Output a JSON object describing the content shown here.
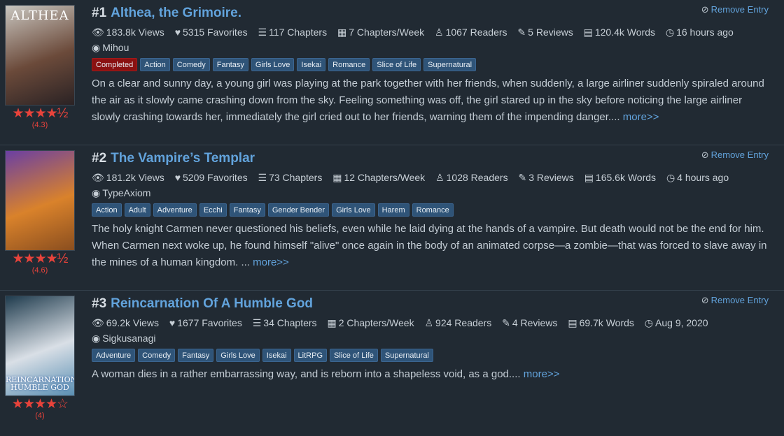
{
  "entries": [
    {
      "rank": "#1",
      "title": "Althea, the Grimoire.",
      "remove_label": "Remove Entry",
      "cover_title": "ALTHEA",
      "cover_bottom": "",
      "cover_colors": [
        "#c9c6c0",
        "#6b4a3a",
        "#2a2224"
      ],
      "stars": "★★★★½",
      "rating": "(4.3)",
      "stats": {
        "views": "183.8k Views",
        "favorites": "5315 Favorites",
        "chapters": "117 Chapters",
        "frequency": "7 Chapters/Week",
        "readers": "1067 Readers",
        "reviews": "5 Reviews",
        "words": "120.4k Words",
        "updated": "16 hours ago"
      },
      "author": "Mihou",
      "status_tag": "Completed",
      "tags": [
        "Action",
        "Comedy",
        "Fantasy",
        "Girls Love",
        "Isekai",
        "Romance",
        "Slice of Life",
        "Supernatural"
      ],
      "description": "On a clear and sunny day, a young girl was playing at the park together with her friends, when suddenly, a large airliner suddenly spiraled around the air as it slowly came crashing down from the sky. Feeling something was off, the girl stared up in the sky before noticing the large airliner slowly crashing towards her, immediately the girl cried out to her friends, warning them of the impending danger....",
      "more_label": "more>>"
    },
    {
      "rank": "#2",
      "title": "The Vampire’s Templar",
      "remove_label": "Remove Entry",
      "cover_title": "",
      "cover_bottom": "",
      "cover_colors": [
        "#6a3fa3",
        "#d9822b",
        "#8a4e1f"
      ],
      "stars": "★★★★½",
      "rating": "(4.6)",
      "stats": {
        "views": "181.2k Views",
        "favorites": "5209 Favorites",
        "chapters": "73 Chapters",
        "frequency": "12 Chapters/Week",
        "readers": "1028 Readers",
        "reviews": "3 Reviews",
        "words": "165.6k Words",
        "updated": "4 hours ago"
      },
      "author": "TypeAxiom",
      "status_tag": "",
      "tags": [
        "Action",
        "Adult",
        "Adventure",
        "Ecchi",
        "Fantasy",
        "Gender Bender",
        "Girls Love",
        "Harem",
        "Romance"
      ],
      "description": "The holy knight Carmen never questioned his beliefs, even while he laid dying at the hands of a vampire. But death would not be the end for him. When Carmen next woke up, he found himself \"alive\" once again in the body of an animated corpse—a zombie—that was forced to slave away in the mines of a human kingdom. ...",
      "more_label": "more>>"
    },
    {
      "rank": "#3",
      "title": "Reincarnation Of A Humble God",
      "remove_label": "Remove Entry",
      "cover_title": "",
      "cover_bottom": "REINCARNATION HUMBLE GOD",
      "cover_colors": [
        "#1f3b4d",
        "#d9dfe6",
        "#5a8fb3"
      ],
      "stars": "★★★★☆",
      "rating": "(4)",
      "stats": {
        "views": "69.2k Views",
        "favorites": "1677 Favorites",
        "chapters": "34 Chapters",
        "frequency": "2 Chapters/Week",
        "readers": "924 Readers",
        "reviews": "4 Reviews",
        "words": "69.7k Words",
        "updated": "Aug 9, 2020"
      },
      "author": "Sigkusanagi",
      "status_tag": "",
      "tags": [
        "Adventure",
        "Comedy",
        "Fantasy",
        "Girls Love",
        "Isekai",
        "LitRPG",
        "Slice of Life",
        "Supernatural"
      ],
      "description": "A woman dies in a rather embarrassing way, and is reborn into a shapeless void, as a god....",
      "more_label": "more>>"
    }
  ]
}
